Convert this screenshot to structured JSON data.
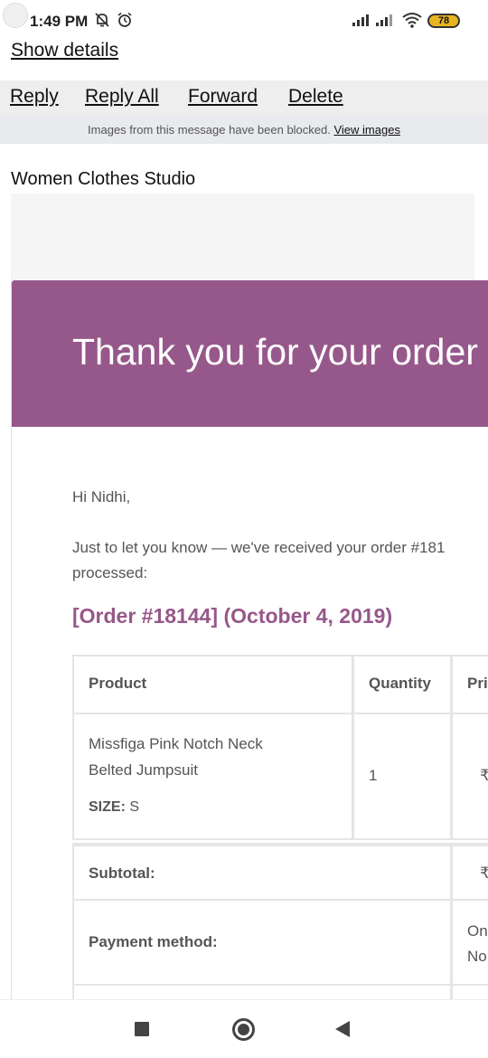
{
  "status_bar": {
    "time": "1:49 PM",
    "icons": [
      "mute-bell-icon",
      "alarm-icon",
      "signal-icon",
      "signal-icon",
      "wifi-icon"
    ],
    "battery": "78"
  },
  "header": {
    "show_details": "Show details"
  },
  "actions": {
    "reply": "Reply",
    "reply_all": "Reply All",
    "forward": "Forward",
    "delete": "Delete"
  },
  "blocked": {
    "message": "Images from this message have been blocked.",
    "link": "View images"
  },
  "sender": "Women Clothes Studio",
  "email": {
    "banner_title": "Thank you for your order",
    "greeting": "Hi Nidhi,",
    "intro_line1": "Just to let you know — we've received your order #181",
    "intro_line2": "processed:",
    "order_heading": "[Order #18144] (October 4, 2019)",
    "table": {
      "headers": {
        "product": "Product",
        "quantity": "Quantity",
        "price": "Pri"
      },
      "item": {
        "name_line1": "Missfiga Pink Notch Neck",
        "name_line2": "Belted Jumpsuit",
        "size_label": "SIZE:",
        "size_value": "S",
        "quantity": "1",
        "price": "₹"
      },
      "subtotal_label": "Subtotal:",
      "subtotal_value": "₹",
      "payment_label": "Payment method:",
      "payment_value_line1": "On",
      "payment_value_line2": "No"
    }
  },
  "colors": {
    "brand": "#96588a",
    "action_bar": "#eeeeee",
    "blocked_bar": "#e8eaee"
  }
}
